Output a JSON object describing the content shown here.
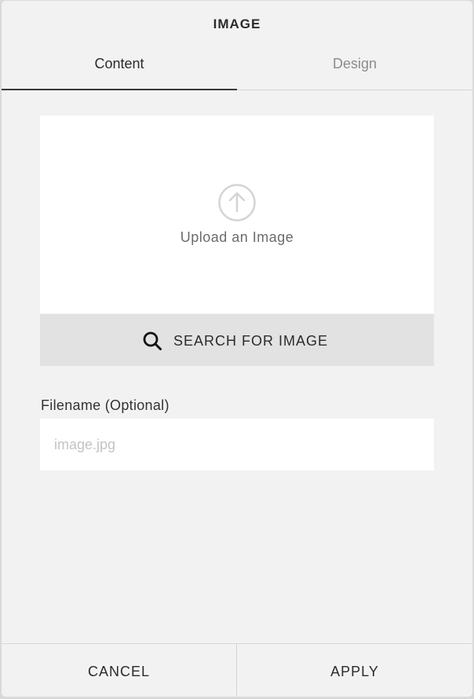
{
  "dialog": {
    "title": "IMAGE"
  },
  "tabs": [
    {
      "label": "Content",
      "active": true
    },
    {
      "label": "Design",
      "active": false
    }
  ],
  "upload": {
    "label": "Upload an Image",
    "icon": "upload-arrow-icon"
  },
  "search": {
    "label": "SEARCH FOR IMAGE",
    "icon": "search-icon"
  },
  "filename": {
    "label": "Filename (Optional)",
    "placeholder": "image.jpg",
    "value": ""
  },
  "footer": {
    "cancel_label": "CANCEL",
    "apply_label": "APPLY"
  },
  "colors": {
    "background": "#f2f2f2",
    "active_tab_underline": "#3a3a3a",
    "search_button_bg": "#e2e2e2"
  }
}
